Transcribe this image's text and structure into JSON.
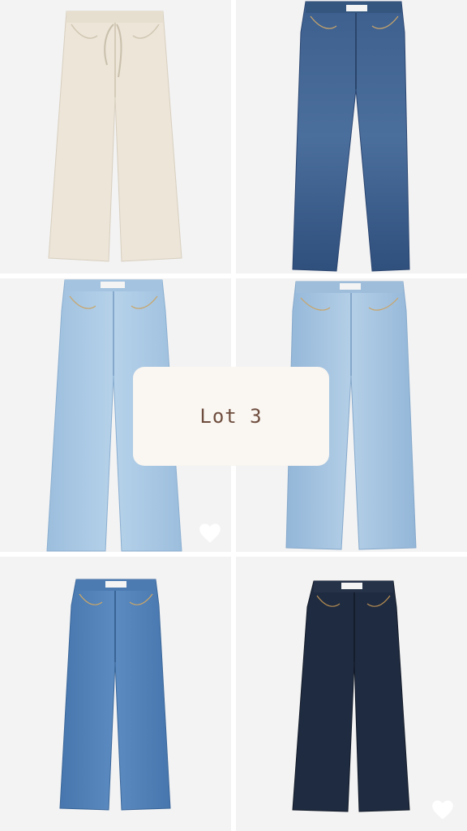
{
  "overlay": {
    "label": "Lot 3"
  },
  "products": [
    {
      "name": "jeans-ecru-wide",
      "color": "#ece5d8"
    },
    {
      "name": "jeans-dark-blue-straight",
      "color": "#3e5f8c"
    },
    {
      "name": "jeans-light-blue-wide",
      "color": "#a7c6e2"
    },
    {
      "name": "jeans-light-blue-straight",
      "color": "#9ebedd"
    },
    {
      "name": "jeans-mid-blue-wide",
      "color": "#4f7fb6"
    },
    {
      "name": "jeans-raw-navy-wide",
      "color": "#1e2a3e"
    }
  ],
  "icons": {
    "like": "heart-icon"
  }
}
